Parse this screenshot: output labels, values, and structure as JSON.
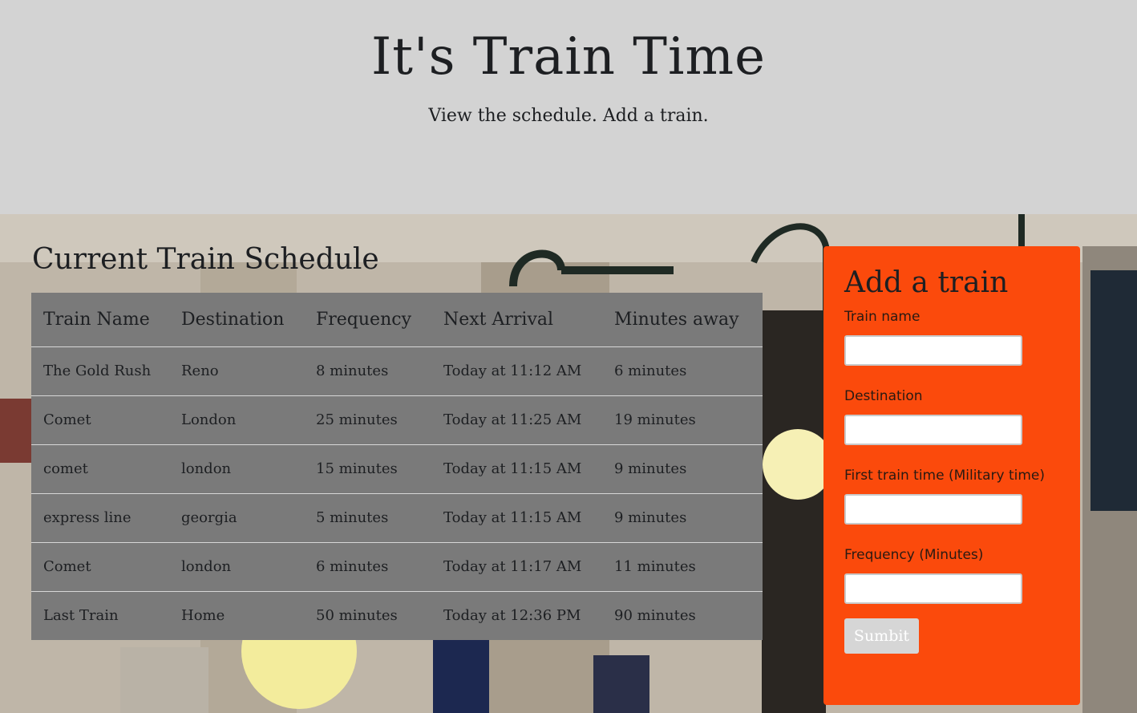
{
  "header": {
    "title": "It's Train Time",
    "subtitle": "View the schedule. Add a train."
  },
  "schedule": {
    "heading": "Current Train Schedule",
    "columns": [
      "Train Name",
      "Destination",
      "Frequency",
      "Next Arrival",
      "Minutes away"
    ],
    "rows": [
      [
        "The Gold Rush",
        "Reno",
        "8 minutes",
        "Today at 11:12 AM",
        "6 minutes"
      ],
      [
        "Comet",
        "London",
        "25 minutes",
        "Today at 11:25 AM",
        "19 minutes"
      ],
      [
        "comet",
        "london",
        "15 minutes",
        "Today at 11:15 AM",
        "9 minutes"
      ],
      [
        "express line",
        "georgia",
        "5 minutes",
        "Today at 11:15 AM",
        "9 minutes"
      ],
      [
        "Comet",
        "london",
        "6 minutes",
        "Today at 11:17 AM",
        "11 minutes"
      ],
      [
        "Last Train",
        "Home",
        "50 minutes",
        "Today at 12:36 PM",
        "90 minutes"
      ]
    ]
  },
  "form": {
    "title": "Add a train",
    "fields": [
      {
        "label": "Train name",
        "value": ""
      },
      {
        "label": "Destination",
        "value": ""
      },
      {
        "label": "First train time (Military time)",
        "value": ""
      },
      {
        "label": "Frequency (Minutes)",
        "value": ""
      }
    ],
    "submit_label": "Sumbit"
  },
  "colors": {
    "jumbotron_bg": "#d3d3d3",
    "table_bg": "#7a7a7a",
    "form_bg": "#fb4a0c",
    "submit_bg": "#d6d6d6"
  }
}
